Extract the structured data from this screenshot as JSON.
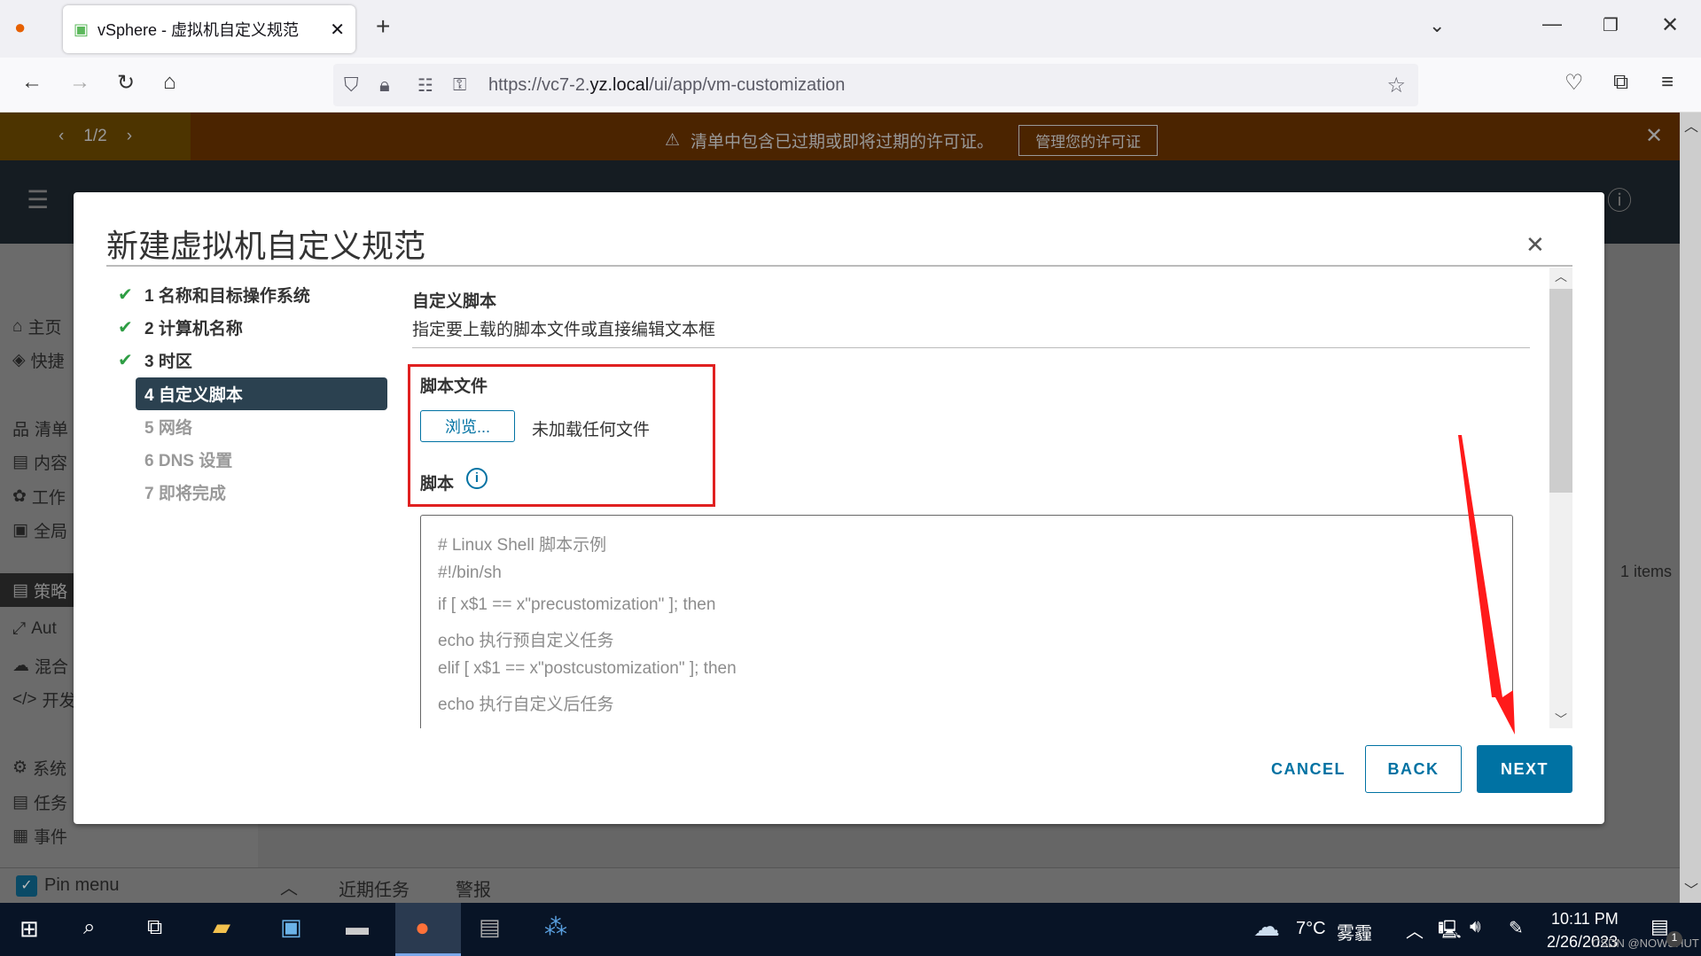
{
  "browser": {
    "tab_title": "vSphere - 虚拟机自定义规范",
    "url_prefix": "https://vc7-2.",
    "url_domain": "yz.local",
    "url_path": "/ui/app/vm-customization"
  },
  "banner": {
    "pager": "1/2",
    "message": "清单中包含已过期或即将过期的许可证。",
    "manage_button": "管理您的许可证"
  },
  "sidebar": {
    "items": [
      "主页",
      "快捷",
      "清单",
      "内容",
      "工作",
      "全局",
      "策略",
      "Aut",
      "混合",
      "开发",
      "系统",
      "任务",
      "事件"
    ],
    "pin_menu": "Pin menu"
  },
  "bottom_tabs": {
    "recent_tasks": "近期任务",
    "alarms": "警报"
  },
  "background": {
    "items_count": "1 items"
  },
  "modal": {
    "title": "新建虚拟机自定义规范",
    "steps": [
      {
        "label": "1 名称和目标操作系统",
        "state": "done"
      },
      {
        "label": "2 计算机名称",
        "state": "done"
      },
      {
        "label": "3 时区",
        "state": "done"
      },
      {
        "label": "4 自定义脚本",
        "state": "active"
      },
      {
        "label": "5 网络",
        "state": "todo"
      },
      {
        "label": "6 DNS 设置",
        "state": "todo"
      },
      {
        "label": "7 即将完成",
        "state": "todo"
      }
    ],
    "section_title": "自定义脚本",
    "section_desc": "指定要上载的脚本文件或直接编辑文本框",
    "script_file_label": "脚本文件",
    "browse_button": "浏览...",
    "no_file": "未加载任何文件",
    "script_label": "脚本",
    "script_placeholder": [
      "# Linux Shell 脚本示例",
      "#!/bin/sh",
      "if [ x$1 == x\"precustomization\" ]; then",
      "echo 执行预自定义任务",
      "elif [ x$1 == x\"postcustomization\" ]; then",
      "echo 执行自定义后任务"
    ],
    "cancel": "CANCEL",
    "back": "BACK",
    "next": "NEXT"
  },
  "taskbar": {
    "temperature": "7°C",
    "weather": "雾霾",
    "time": "10:11 PM",
    "date": "2/26/2023",
    "notification_count": "1",
    "watermark": "CSDN @NOWSHUT"
  },
  "colors": {
    "accent": "#0072a3",
    "highlight_box": "#e02020",
    "banner": "#b54d00",
    "check": "#2e9e44"
  }
}
